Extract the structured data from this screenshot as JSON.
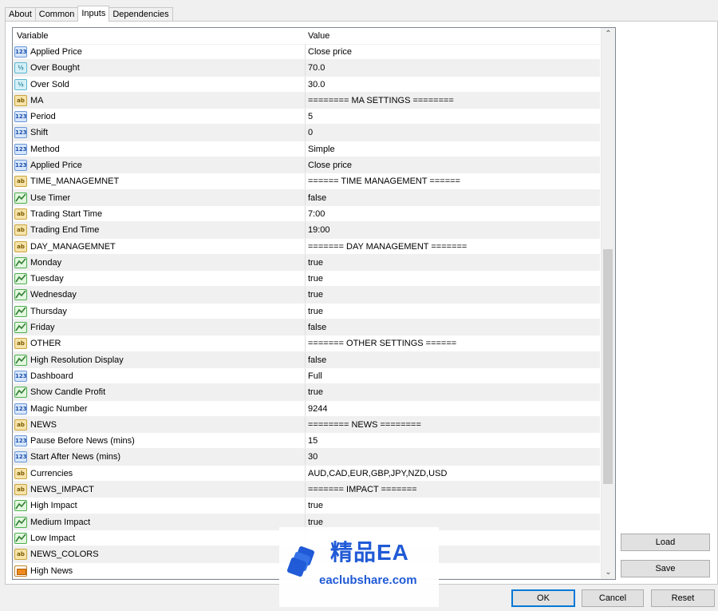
{
  "tabs": [
    {
      "label": "About",
      "active": false
    },
    {
      "label": "Common",
      "active": false
    },
    {
      "label": "Inputs",
      "active": true
    },
    {
      "label": "Dependencies",
      "active": false
    }
  ],
  "table": {
    "columns": [
      "Variable",
      "Value"
    ],
    "rows": [
      {
        "type": "int",
        "icon": "integer-icon",
        "name": "Applied Price",
        "value": "Close price"
      },
      {
        "type": "dbl",
        "icon": "double-icon",
        "name": "Over Bought",
        "value": "70.0"
      },
      {
        "type": "dbl",
        "icon": "double-icon",
        "name": "Over Sold",
        "value": "30.0"
      },
      {
        "type": "str",
        "icon": "string-icon",
        "name": "MA",
        "value": "======== MA SETTINGS ========"
      },
      {
        "type": "int",
        "icon": "integer-icon",
        "name": "Period",
        "value": "5"
      },
      {
        "type": "int",
        "icon": "integer-icon",
        "name": "Shift",
        "value": "0"
      },
      {
        "type": "int",
        "icon": "integer-icon",
        "name": "Method",
        "value": "Simple"
      },
      {
        "type": "int",
        "icon": "integer-icon",
        "name": "Applied Price",
        "value": "Close price"
      },
      {
        "type": "str",
        "icon": "string-icon",
        "name": "TIME_MANAGEMNET",
        "value": "====== TIME MANAGEMENT ======"
      },
      {
        "type": "bool",
        "icon": "boolean-icon",
        "name": "Use Timer",
        "value": "false"
      },
      {
        "type": "str",
        "icon": "string-icon",
        "name": "Trading Start Time",
        "value": "7:00"
      },
      {
        "type": "str",
        "icon": "string-icon",
        "name": "Trading End Time",
        "value": "19:00"
      },
      {
        "type": "str",
        "icon": "string-icon",
        "name": "DAY_MANAGEMNET",
        "value": "======= DAY MANAGEMENT ======="
      },
      {
        "type": "bool",
        "icon": "boolean-icon",
        "name": "Monday",
        "value": "true"
      },
      {
        "type": "bool",
        "icon": "boolean-icon",
        "name": "Tuesday",
        "value": "true"
      },
      {
        "type": "bool",
        "icon": "boolean-icon",
        "name": "Wednesday",
        "value": "true"
      },
      {
        "type": "bool",
        "icon": "boolean-icon",
        "name": "Thursday",
        "value": "true"
      },
      {
        "type": "bool",
        "icon": "boolean-icon",
        "name": "Friday",
        "value": "false"
      },
      {
        "type": "str",
        "icon": "string-icon",
        "name": "OTHER",
        "value": "======= OTHER SETTINGS ======"
      },
      {
        "type": "bool",
        "icon": "boolean-icon",
        "name": "High Resolution Display",
        "value": "false"
      },
      {
        "type": "int",
        "icon": "integer-icon",
        "name": "Dashboard",
        "value": "Full"
      },
      {
        "type": "bool",
        "icon": "boolean-icon",
        "name": "Show Candle Profit",
        "value": "true"
      },
      {
        "type": "int",
        "icon": "integer-icon",
        "name": "Magic Number",
        "value": "9244"
      },
      {
        "type": "str",
        "icon": "string-icon",
        "name": "NEWS",
        "value": "======== NEWS ========"
      },
      {
        "type": "int",
        "icon": "integer-icon",
        "name": "Pause Before News (mins)",
        "value": "15"
      },
      {
        "type": "int",
        "icon": "integer-icon",
        "name": "Start After News (mins)",
        "value": "30"
      },
      {
        "type": "str",
        "icon": "string-icon",
        "name": "Currencies",
        "value": "AUD,CAD,EUR,GBP,JPY,NZD,USD"
      },
      {
        "type": "str",
        "icon": "string-icon",
        "name": "NEWS_IMPACT",
        "value": "======= IMPACT ======="
      },
      {
        "type": "bool",
        "icon": "boolean-icon",
        "name": "High Impact",
        "value": "true"
      },
      {
        "type": "bool",
        "icon": "boolean-icon",
        "name": "Medium Impact",
        "value": "true"
      },
      {
        "type": "bool",
        "icon": "boolean-icon",
        "name": "Low Impact",
        "value": ""
      },
      {
        "type": "str",
        "icon": "string-icon",
        "name": "NEWS_COLORS",
        "value": ""
      },
      {
        "type": "col",
        "icon": "color-icon",
        "name": "High News",
        "value": ""
      }
    ]
  },
  "icon_labels": {
    "int": "123",
    "dbl": "½",
    "str": "ab",
    "bool": "",
    "col": ""
  },
  "side_buttons": {
    "load": "Load",
    "save": "Save"
  },
  "footer": {
    "ok": "OK",
    "cancel": "Cancel",
    "reset": "Reset"
  },
  "watermark": {
    "title": "精品EA",
    "url": "eaclubshare.com"
  }
}
